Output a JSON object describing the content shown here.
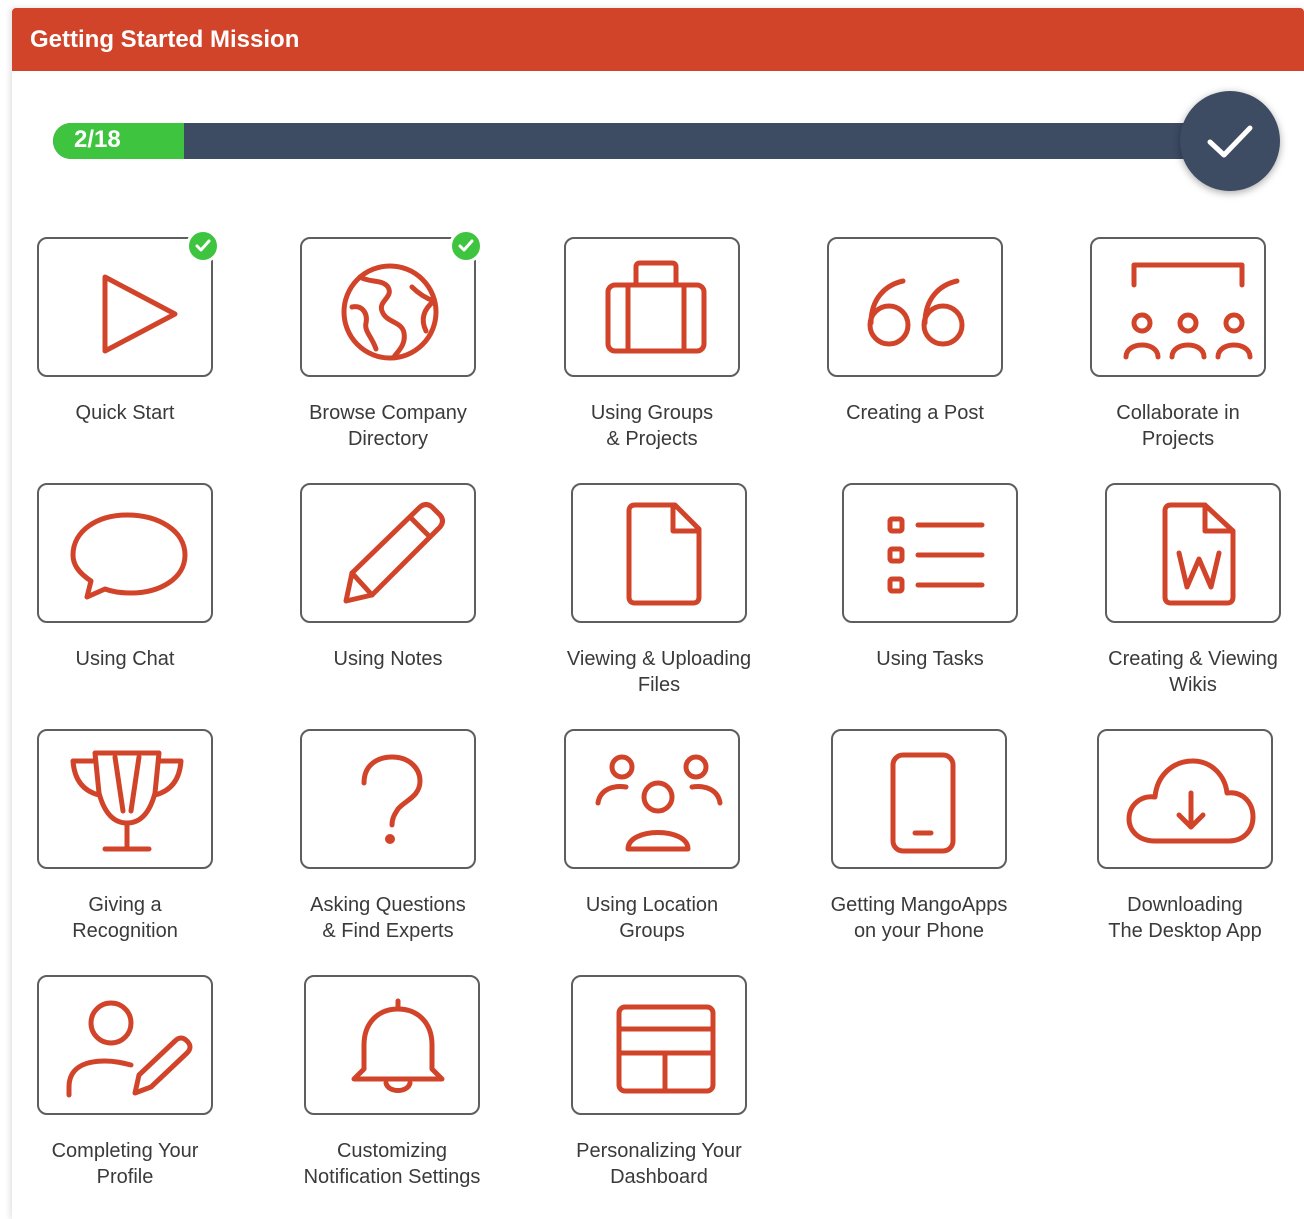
{
  "header": {
    "title": "Getting Started Mission"
  },
  "progress": {
    "label": "2/18",
    "completed": 2,
    "total": 18
  },
  "finish_icon": "check-icon",
  "tiles": [
    {
      "icon": "play-icon",
      "completed": true,
      "label_lines": [
        "Quick Start"
      ]
    },
    {
      "icon": "globe-icon",
      "completed": true,
      "label_lines": [
        "Browse Company",
        "Directory"
      ]
    },
    {
      "icon": "briefcase-icon",
      "completed": false,
      "label_lines": [
        "Using Groups",
        "& Projects"
      ]
    },
    {
      "icon": "quote-icon",
      "completed": false,
      "label_lines": [
        "Creating a Post"
      ]
    },
    {
      "icon": "presentation-people-icon",
      "completed": false,
      "label_lines": [
        "Collaborate in",
        "Projects"
      ]
    },
    {
      "icon": "chat-bubble-icon",
      "completed": false,
      "label_lines": [
        "Using Chat"
      ]
    },
    {
      "icon": "pencil-icon",
      "completed": false,
      "label_lines": [
        "Using Notes"
      ]
    },
    {
      "icon": "file-icon",
      "completed": false,
      "label_lines": [
        "Viewing & Uploading",
        "Files"
      ]
    },
    {
      "icon": "task-list-icon",
      "completed": false,
      "label_lines": [
        "Using Tasks"
      ]
    },
    {
      "icon": "word-document-icon",
      "completed": false,
      "label_lines": [
        "Creating & Viewing",
        "Wikis"
      ]
    },
    {
      "icon": "trophy-icon",
      "completed": false,
      "label_lines": [
        "Giving a",
        "Recognition"
      ]
    },
    {
      "icon": "question-mark-icon",
      "completed": false,
      "label_lines": [
        "Asking Questions",
        "& Find Experts"
      ]
    },
    {
      "icon": "group-people-icon",
      "completed": false,
      "label_lines": [
        "Using Location",
        "Groups"
      ]
    },
    {
      "icon": "phone-icon",
      "completed": false,
      "label_lines": [
        "Getting MangoApps",
        "on your Phone"
      ]
    },
    {
      "icon": "cloud-download-icon",
      "completed": false,
      "label_lines": [
        "Downloading",
        "The Desktop App"
      ]
    },
    {
      "icon": "user-edit-icon",
      "completed": false,
      "label_lines": [
        "Completing Your",
        "Profile"
      ]
    },
    {
      "icon": "bell-icon",
      "completed": false,
      "label_lines": [
        "Customizing",
        "Notification Settings"
      ]
    },
    {
      "icon": "dashboard-grid-icon",
      "completed": false,
      "label_lines": [
        "Personalizing Your",
        "Dashboard"
      ]
    }
  ],
  "colors": {
    "header": "#d2442a",
    "icon_stroke": "#d2442a",
    "progress_track": "#3d4b63",
    "progress_fill": "#3fc43f",
    "completed_badge": "#3fc43f"
  }
}
